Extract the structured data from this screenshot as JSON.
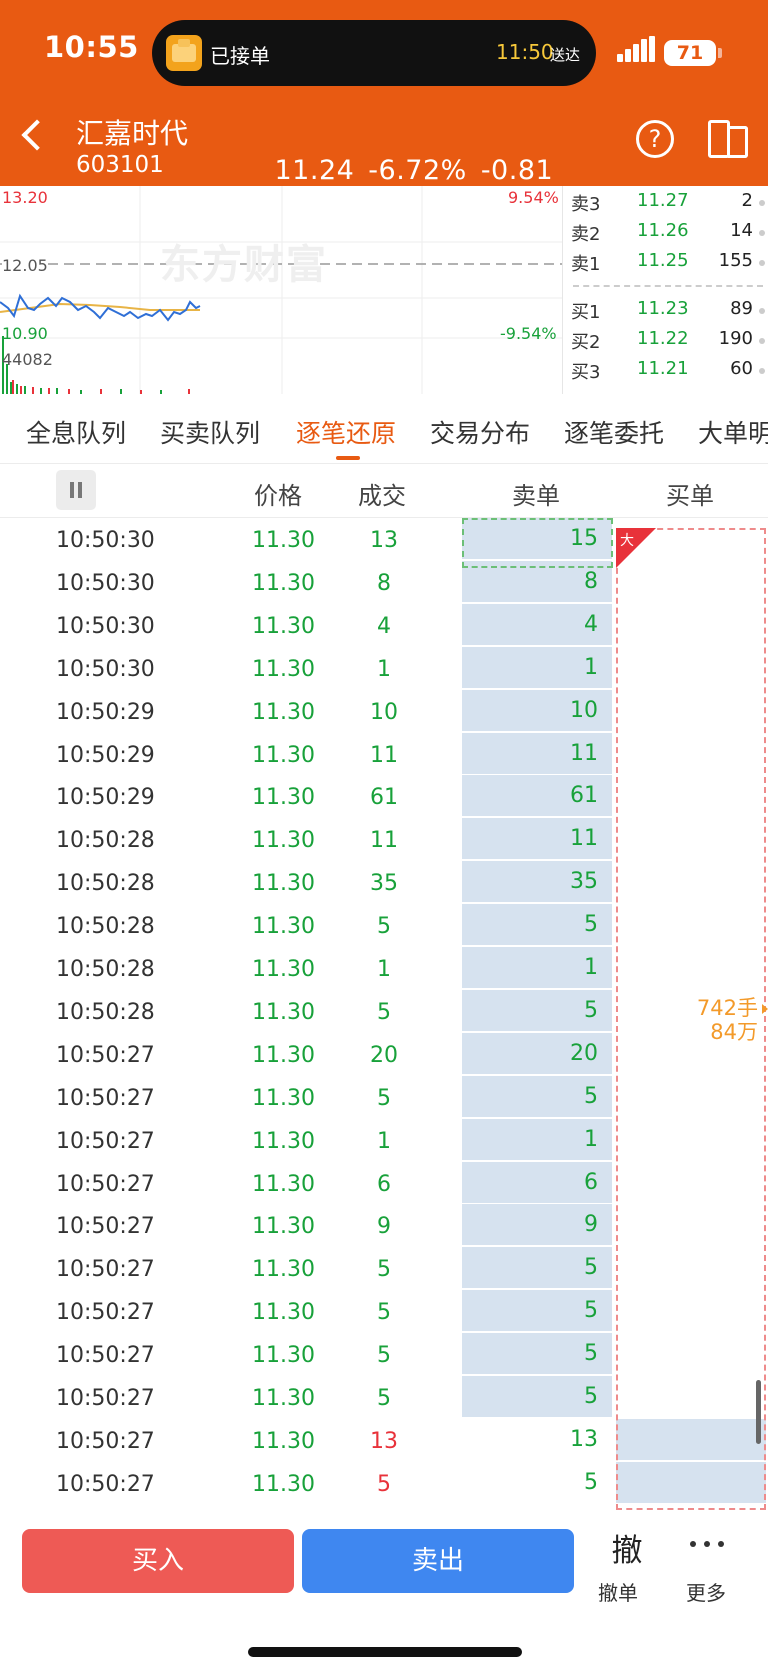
{
  "status": {
    "time": "10:55",
    "island_text": "已接单",
    "island_eta": "11:50",
    "island_eta_label": "送达",
    "battery": "71"
  },
  "stock": {
    "name": "汇嘉时代",
    "code": "603101",
    "price": "11.24",
    "change_pct": "-6.72%",
    "change": "-0.81"
  },
  "chart": {
    "watermark": "东方财富",
    "high": "13.20",
    "high_pct": "9.54%",
    "mid": "12.05",
    "low": "10.90",
    "low_pct": "-9.54%",
    "volume": "44082"
  },
  "orderbook": [
    {
      "label": "卖3",
      "price": "11.27",
      "volume": "2"
    },
    {
      "label": "卖2",
      "price": "11.26",
      "volume": "14"
    },
    {
      "label": "卖1",
      "price": "11.25",
      "volume": "155"
    },
    {
      "label": "买1",
      "price": "11.23",
      "volume": "89"
    },
    {
      "label": "买2",
      "price": "11.22",
      "volume": "190"
    },
    {
      "label": "买3",
      "price": "11.21",
      "volume": "60"
    }
  ],
  "tabs": [
    "全息队列",
    "买卖队列",
    "逐笔还原",
    "交易分布",
    "逐笔委托",
    "大单明"
  ],
  "active_tab": "逐笔还原",
  "table_headers": {
    "price": "价格",
    "volume": "成交",
    "sell": "卖单",
    "buy": "买单"
  },
  "big_order": {
    "flag": "大",
    "hands": "742手",
    "amount": "84万"
  },
  "trades": [
    {
      "time": "10:50:30",
      "price": "11.30",
      "volume": "13",
      "sell": "15",
      "side": "sell"
    },
    {
      "time": "10:50:30",
      "price": "11.30",
      "volume": "8",
      "sell": "8",
      "side": "sell"
    },
    {
      "time": "10:50:30",
      "price": "11.30",
      "volume": "4",
      "sell": "4",
      "side": "sell"
    },
    {
      "time": "10:50:30",
      "price": "11.30",
      "volume": "1",
      "sell": "1",
      "side": "sell"
    },
    {
      "time": "10:50:29",
      "price": "11.30",
      "volume": "10",
      "sell": "10",
      "side": "sell"
    },
    {
      "time": "10:50:29",
      "price": "11.30",
      "volume": "11",
      "sell": "11",
      "side": "sell"
    },
    {
      "time": "10:50:29",
      "price": "11.30",
      "volume": "61",
      "sell": "61",
      "side": "sell"
    },
    {
      "time": "10:50:28",
      "price": "11.30",
      "volume": "11",
      "sell": "11",
      "side": "sell"
    },
    {
      "time": "10:50:28",
      "price": "11.30",
      "volume": "35",
      "sell": "35",
      "side": "sell"
    },
    {
      "time": "10:50:28",
      "price": "11.30",
      "volume": "5",
      "sell": "5",
      "side": "sell"
    },
    {
      "time": "10:50:28",
      "price": "11.30",
      "volume": "1",
      "sell": "1",
      "side": "sell"
    },
    {
      "time": "10:50:28",
      "price": "11.30",
      "volume": "5",
      "sell": "5",
      "side": "sell"
    },
    {
      "time": "10:50:27",
      "price": "11.30",
      "volume": "20",
      "sell": "20",
      "side": "sell"
    },
    {
      "time": "10:50:27",
      "price": "11.30",
      "volume": "5",
      "sell": "5",
      "side": "sell"
    },
    {
      "time": "10:50:27",
      "price": "11.30",
      "volume": "1",
      "sell": "1",
      "side": "sell"
    },
    {
      "time": "10:50:27",
      "price": "11.30",
      "volume": "6",
      "sell": "6",
      "side": "sell"
    },
    {
      "time": "10:50:27",
      "price": "11.30",
      "volume": "9",
      "sell": "9",
      "side": "sell"
    },
    {
      "time": "10:50:27",
      "price": "11.30",
      "volume": "5",
      "sell": "5",
      "side": "sell"
    },
    {
      "time": "10:50:27",
      "price": "11.30",
      "volume": "5",
      "sell": "5",
      "side": "sell"
    },
    {
      "time": "10:50:27",
      "price": "11.30",
      "volume": "5",
      "sell": "5",
      "side": "sell"
    },
    {
      "time": "10:50:27",
      "price": "11.30",
      "volume": "5",
      "sell": "5",
      "side": "sell"
    },
    {
      "time": "10:50:27",
      "price": "11.30",
      "volume": "13",
      "sell": "13",
      "side": "buy"
    },
    {
      "time": "10:50:27",
      "price": "11.30",
      "volume": "5",
      "sell": "5",
      "side": "buy"
    }
  ],
  "bottom": {
    "buy": "买入",
    "sell": "卖出",
    "withdraw_icon": "撤",
    "withdraw": "撤单",
    "more": "更多"
  },
  "colors": {
    "brand": "#e85a12",
    "up": "#e8323a",
    "down": "#18a13a",
    "buy_button": "#ee5a55",
    "sell_button": "#3f87f0",
    "queue_fill": "#d6e2ef"
  }
}
